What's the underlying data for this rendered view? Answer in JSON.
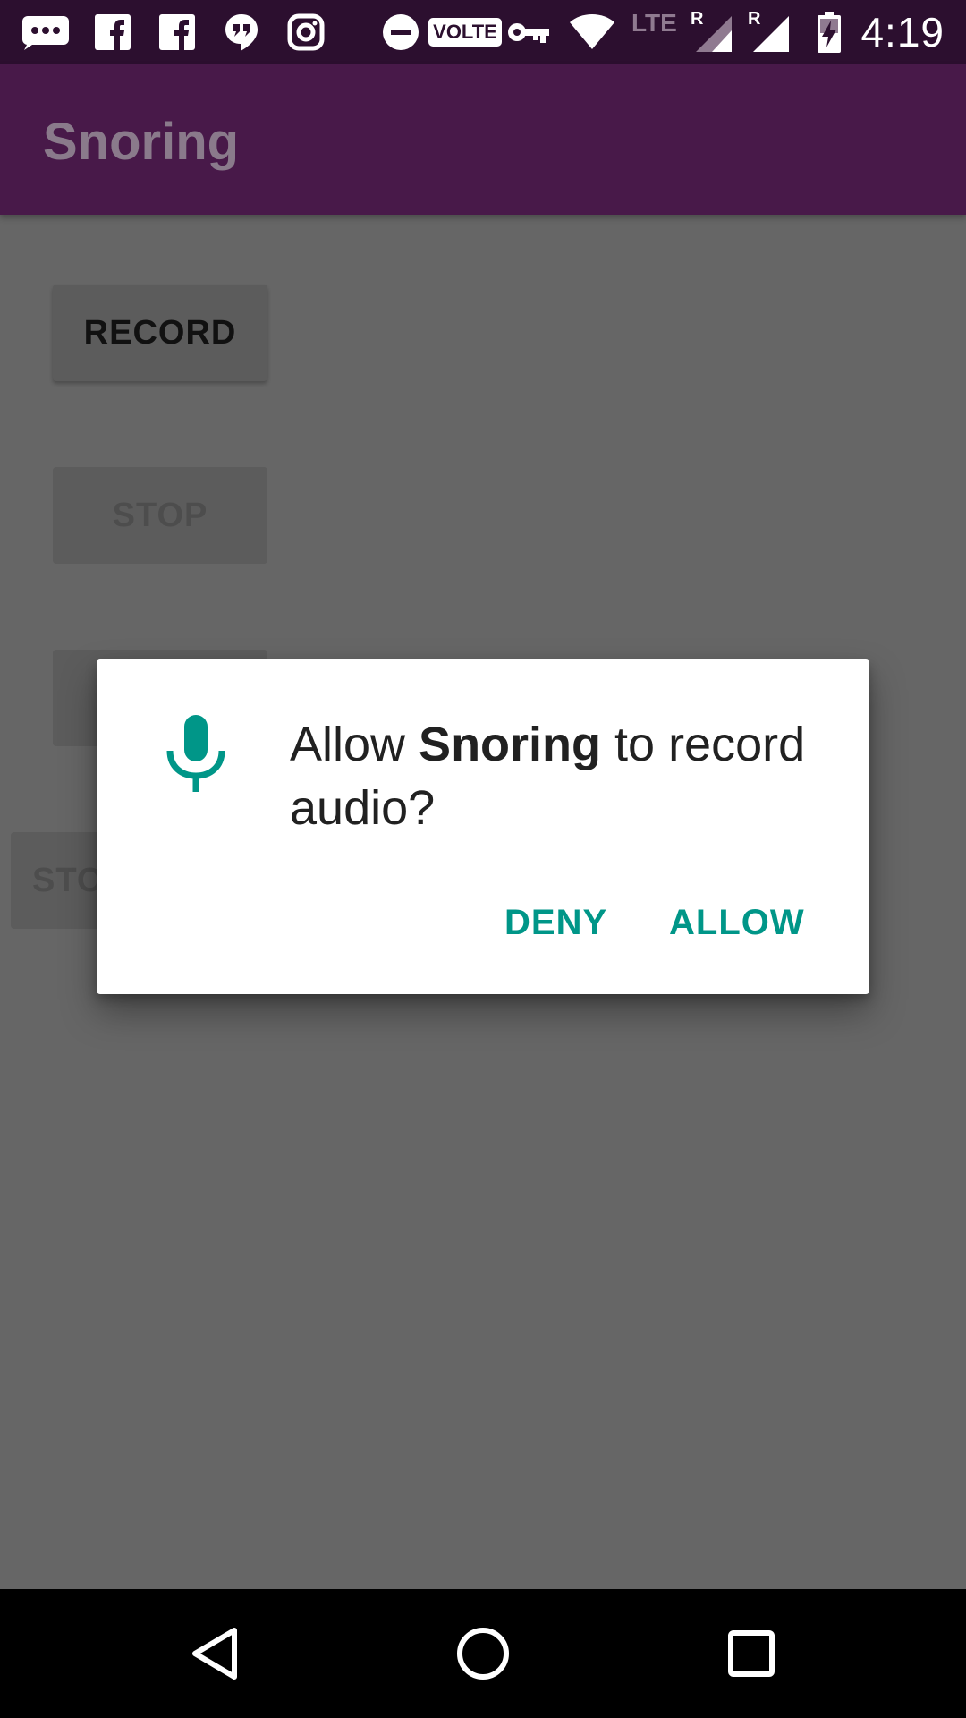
{
  "status_bar": {
    "time": "4:19",
    "network": "LTE",
    "icons": [
      "messages-icon",
      "facebook-icon",
      "facebook-icon",
      "hangouts-icon",
      "instagram-icon",
      "do-not-disturb-icon",
      "volte-icon",
      "vpn-key-icon",
      "wifi-icon",
      "signal-icon",
      "signal-icon",
      "battery-charging-icon"
    ],
    "volte_label": "VOLTE",
    "roaming_label": "R"
  },
  "app_bar": {
    "title": "Snoring"
  },
  "content": {
    "record_label": "RECORD",
    "stop_label": "STOP",
    "stop_label_2": "STO"
  },
  "dialog": {
    "prefix": "Allow ",
    "app_name": "Snoring",
    "suffix": " to record audio?",
    "deny_label": "DENY",
    "allow_label": "ALLOW",
    "icon": "microphone-icon",
    "accent_color": "#009688"
  },
  "nav_bar": {
    "buttons": [
      "back-icon",
      "home-icon",
      "recents-icon"
    ]
  },
  "colors": {
    "status_bar": "#2c0f2f",
    "app_bar": "#481949",
    "scrim_background": "#666666",
    "accent": "#009688"
  }
}
